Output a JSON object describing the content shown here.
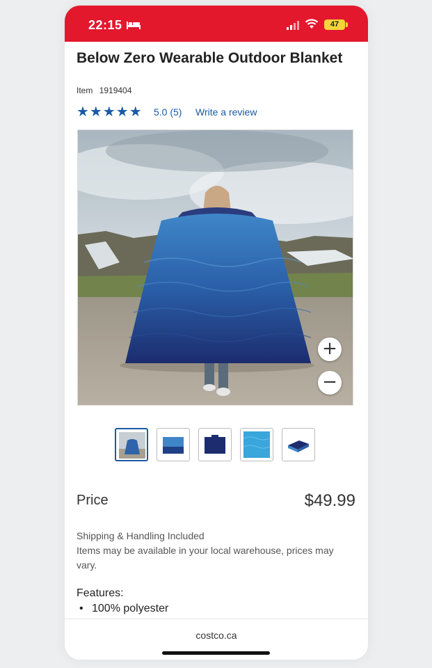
{
  "status_bar": {
    "time": "22:15",
    "battery": "47",
    "icons": [
      "bed-icon",
      "cellular-signal-icon",
      "wifi-icon",
      "battery-icon"
    ],
    "color": "#e3182d"
  },
  "product": {
    "title": "Below Zero Wearable Outdoor Blanket",
    "item_label": "Item",
    "item_number": "1919404",
    "stars": "★★★★★",
    "rating": "5.0 (5)",
    "write_review": "Write a review",
    "rating_value": 5.0,
    "review_count": 5,
    "accent_color": "#1b5aa5"
  },
  "gallery": {
    "zoom_in": "+",
    "zoom_out": "−",
    "selected_index": 0,
    "thumbnail_count": 5
  },
  "pricing": {
    "label": "Price",
    "value": "$49.99",
    "shipping_line": "Shipping & Handling Included",
    "availability": "Items may be available in your local warehouse, prices may vary."
  },
  "features": {
    "title": "Features:",
    "items": [
      "100% polyester"
    ]
  },
  "browser": {
    "domain": "costco.ca"
  }
}
